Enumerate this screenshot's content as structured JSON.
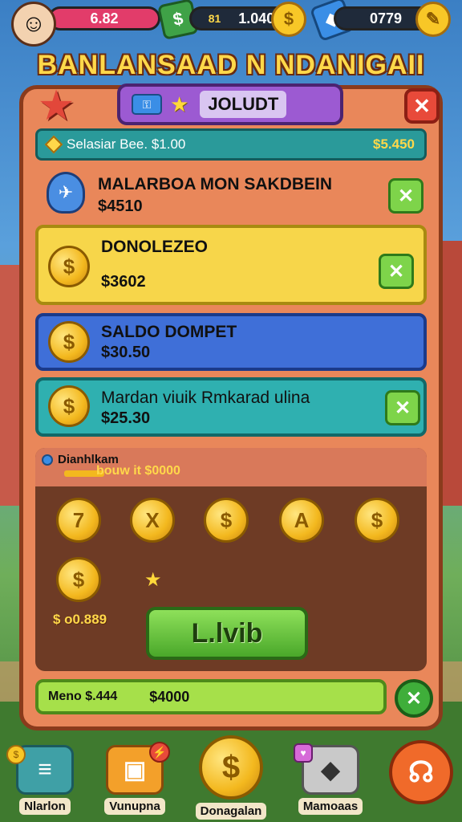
{
  "colors": {
    "panel": "#e9875a",
    "accent_gold": "#ffd84a",
    "tab_purple": "#9c5ad2",
    "teal": "#2a9a9a"
  },
  "topbar": {
    "hearts": "6.82",
    "cash_badge": "81",
    "cash": "1.040",
    "gems": "0779",
    "avatar_icon": "girl-avatar",
    "coin_icon": "$"
  },
  "title": "BANLANSAAD N NDANIGAII",
  "tab": {
    "label": "JOLUDT",
    "key_icon": "key-icon",
    "star_icon": "★"
  },
  "close_icon": "✕",
  "balance": {
    "label": "Selasiar Bee. $1.00",
    "value": "$5.450"
  },
  "rows": [
    {
      "title": "MALARBOA MON SAKDBEIN",
      "amount": "$4510",
      "action": "✕"
    },
    {
      "title": "DONOLEZEO",
      "amount": "$3602",
      "coin": "$",
      "action": "✕"
    },
    {
      "title": "SALDO DOMPET",
      "amount": "$30.50",
      "coin": "$"
    },
    {
      "title": "Mardan viuik Rmkarad ulina",
      "amount": "$25.30",
      "coin": "$",
      "action": "✕"
    }
  ],
  "wallet": {
    "label": "Dianhlkam",
    "sub": "bouw it $0000",
    "coins": [
      "7",
      "X",
      "$",
      "A",
      "$",
      "$"
    ],
    "amount": "$ o0.889",
    "button_label": "L.lvib",
    "sparkle": "★"
  },
  "progress": {
    "label": "Meno $.444",
    "value": "$4000",
    "action": "✕"
  },
  "nav": [
    {
      "label": "Nlarlon",
      "icon": "≡",
      "badge": "$"
    },
    {
      "label": "Vunupna",
      "icon": "▣",
      "badge": "⚡"
    },
    {
      "label": "Donagalan",
      "icon": "$"
    },
    {
      "label": "Mamoaas",
      "icon": "◆",
      "badge": "♥"
    },
    {
      "label": "",
      "icon": "☊"
    }
  ]
}
